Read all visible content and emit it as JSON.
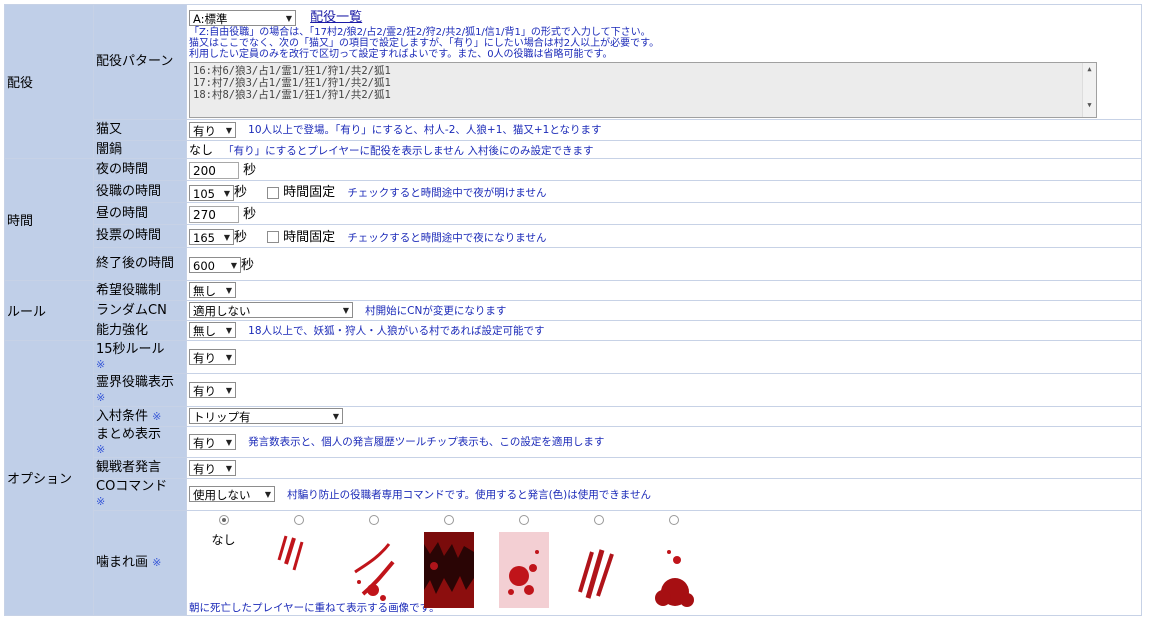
{
  "haiyaku": {
    "category": "配役",
    "pattern_label": "配役パターン",
    "pattern_select": "A:標準",
    "list_link": "配役一覧",
    "help_lines": [
      "「Z:自由役職」の場合は、「17村2/狼2/占2/霊2/狂2/狩2/共2/狐1/信1/背1」の形式で入力して下さい。",
      "猫又はここでなく、次の「猫又」の項目で設定しますが、「有り」にしたい場合は村2人以上が必要です。",
      "利用したい定員のみを改行で区切って設定すればよいです。また、0人の役職は省略可能です。"
    ],
    "textarea_lines": [
      "16:村6/狼3/占1/霊1/狂1/狩1/共2/狐1",
      "17:村7/狼3/占1/霊1/狂1/狩1/共2/狐1",
      "18:村8/狼3/占1/霊1/狂1/狩1/共2/狐1"
    ],
    "nekomata_label": "猫又",
    "nekomata_value": "有り",
    "nekomata_note": "10人以上で登場。「有り」にすると、村人-2、人狼+1、猫又+1となります",
    "yaminabe_label": "闇鍋",
    "yaminabe_value": "なし",
    "yaminabe_note": "「有り」にするとプレイヤーに配役を表示しません 入村後にのみ設定できます"
  },
  "time": {
    "category": "時間",
    "night_label": "夜の時間",
    "night_value": "200",
    "role_label": "役職の時間",
    "role_value": "105",
    "day_label": "昼の時間",
    "day_value": "270",
    "vote_label": "投票の時間",
    "vote_value": "165",
    "after_label": "終了後の時間",
    "after_value": "600",
    "sec": "秒",
    "fixed_label": "時間固定",
    "role_fixed_note": "チェックすると時間途中で夜が明けません",
    "vote_fixed_note": "チェックすると時間途中で夜になりません"
  },
  "rule": {
    "category": "ルール",
    "kibou_label": "希望役職制",
    "kibou_value": "無し",
    "randomcn_label": "ランダムCN",
    "randomcn_value": "適用しない",
    "randomcn_note": "村開始にCNが変更になります",
    "nouryoku_label": "能力強化",
    "nouryoku_value": "無し",
    "nouryoku_note": "18人以上で、妖狐・狩人・人狼がいる村であれば設定可能です"
  },
  "option": {
    "category": "オプション",
    "mark": "※",
    "rule15_label": "15秒ルール",
    "rule15_value": "有り",
    "reikai_label": "霊界役職表示",
    "reikai_value": "有り",
    "nyuson_label": "入村条件",
    "nyuson_value": "トリップ有",
    "matome_label": "まとめ表示",
    "matome_value": "有り",
    "matome_note": "発言数表示と、個人の発言履歴ツールチップ表示も、この設定を適用します",
    "kansen_label": "観戦者発言",
    "kansen_value": "有り",
    "co_label": "COコマンド",
    "co_value": "使用しない",
    "co_note": "村騙り防止の役職者専用コマンドです。使用すると発言(色)は使用できません",
    "kamare_label": "噛まれ画",
    "kamare_none": "なし",
    "kamare_note": "朝に死亡したプレイヤーに重ねて表示する画像です。"
  },
  "colors": {
    "label_bg": "#c0cfe8",
    "note_text": "#1b2ab8",
    "blood": "#c0141a"
  }
}
